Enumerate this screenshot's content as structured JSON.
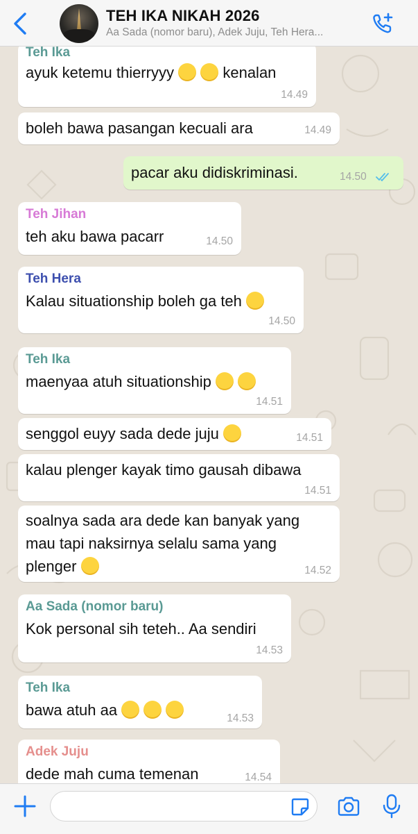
{
  "header": {
    "title": "TEH IKA NIKAH 2026",
    "subtitle": "Aa Sada (nomor baru), Adek Juju, Teh Hera..."
  },
  "colors": {
    "accent": "#1f7cf3",
    "teh_ika": "#5a9a94",
    "teh_jihan": "#d77ad6",
    "teh_hera": "#3d4fae",
    "aa_sada": "#5a9a94",
    "adek_juju": "#e58f8d",
    "outgoing_bubble": "#e1f7cb",
    "read_ticks": "#53bdeb"
  },
  "messages": [
    {
      "sender": "Teh Ika",
      "lines": [
        "ayuk ketemu thierryyy",
        "kenalan"
      ],
      "time": "14.49",
      "emojis": [
        "pleading-face",
        "pleading-face"
      ]
    },
    {
      "lines": [
        "boleh bawa pasangan kecuali ara"
      ],
      "time": "14.49"
    },
    {
      "outgoing": true,
      "lines": [
        "pacar aku didiskriminasi."
      ],
      "time": "14.50",
      "status": "read"
    },
    {
      "sender": "Teh Jihan",
      "lines": [
        "teh aku bawa pacarr"
      ],
      "time": "14.50"
    },
    {
      "sender": "Teh Hera",
      "lines": [
        "Kalau situationship boleh ga teh"
      ],
      "time": "14.50",
      "emojis": [
        "rolling-laughing-face"
      ]
    },
    {
      "sender": "Teh Ika",
      "lines": [
        "maenyaa atuh situationship"
      ],
      "time": "14.51",
      "emojis": [
        "crying-face",
        "rolling-laughing-face"
      ]
    },
    {
      "lines": [
        "senggol euyy sada dede juju"
      ],
      "time": "14.51",
      "emojis": [
        "squinting-tongue-face"
      ]
    },
    {
      "lines": [
        "kalau plenger kayak timo gausah dibawa"
      ],
      "time": "14.51"
    },
    {
      "lines": [
        "soalnya sada ara dede kan banyak yang",
        "mau tapi naksirnya selalu sama yang",
        "plenger"
      ],
      "time": "14.52",
      "emojis": [
        "smiling-face"
      ]
    },
    {
      "sender": "Aa Sada (nomor baru)",
      "lines": [
        "Kok personal sih teteh.. Aa sendiri"
      ],
      "time": "14.53"
    },
    {
      "sender": "Teh Ika",
      "lines": [
        "bawa atuh aa"
      ],
      "time": "14.53",
      "emojis": [
        "squinting-tongue-face",
        "squinting-tongue-face",
        "squinting-tongue-face"
      ]
    },
    {
      "sender": "Adek Juju",
      "lines": [
        "dede mah cuma temenan"
      ],
      "time": "14.54"
    }
  ],
  "composer": {
    "value": "",
    "placeholder": ""
  },
  "icons": {
    "back": "chevron-left-icon",
    "call": "phone-plus-icon",
    "attach": "plus-icon",
    "sticker": "sticker-icon",
    "camera": "camera-icon",
    "mic": "microphone-icon"
  }
}
